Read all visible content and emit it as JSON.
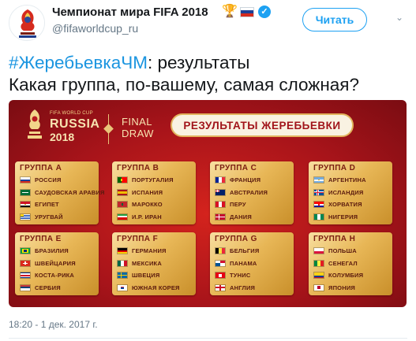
{
  "tweet": {
    "author_name": "Чемпионат мира FIFA 2018",
    "author_handle": "@fifaworldcup_ru",
    "follow_label": "Читать",
    "hashtag": "#ЖеребьевкаЧМ",
    "text_after_hashtag": ": результаты",
    "text_line2": "Какая группа, по-вашему, самая сложная?",
    "timestamp": "18:20 - 1 дек. 2017 г.",
    "icons": [
      "trophy-icon",
      "russia-flag-icon",
      "verified-icon",
      "chevron-down-icon"
    ]
  },
  "media": {
    "logo_small": "FIFA WORLD CUP",
    "logo_country": "RUSSIA",
    "logo_year": "2018",
    "final_draw_line1": "FINAL",
    "final_draw_line2": "DRAW",
    "title": "РЕЗУЛЬТАТЫ ЖЕРЕБЬЕВКИ",
    "groups": [
      {
        "name": "ГРУППА А",
        "teams": [
          {
            "name": "РОССИЯ",
            "flag": "russia-flag"
          },
          {
            "name": "САУДОВСКАЯ АРАВИЯ",
            "flag": "saudi-arabia-flag"
          },
          {
            "name": "ЕГИПЕТ",
            "flag": "egypt-flag"
          },
          {
            "name": "УРУГВАЙ",
            "flag": "uruguay-flag"
          }
        ]
      },
      {
        "name": "ГРУППА B",
        "teams": [
          {
            "name": "ПОРТУГАЛИЯ",
            "flag": "portugal-flag"
          },
          {
            "name": "ИСПАНИЯ",
            "flag": "spain-flag"
          },
          {
            "name": "МАРОККО",
            "flag": "morocco-flag"
          },
          {
            "name": "И.Р. ИРАН",
            "flag": "iran-flag"
          }
        ]
      },
      {
        "name": "ГРУППА C",
        "teams": [
          {
            "name": "ФРАНЦИЯ",
            "flag": "france-flag"
          },
          {
            "name": "АВСТРАЛИЯ",
            "flag": "australia-flag"
          },
          {
            "name": "ПЕРУ",
            "flag": "peru-flag"
          },
          {
            "name": "ДАНИЯ",
            "flag": "denmark-flag"
          }
        ]
      },
      {
        "name": "ГРУППА D",
        "teams": [
          {
            "name": "АРГЕНТИНА",
            "flag": "argentina-flag"
          },
          {
            "name": "ИСЛАНДИЯ",
            "flag": "iceland-flag"
          },
          {
            "name": "ХОРВАТИЯ",
            "flag": "croatia-flag"
          },
          {
            "name": "НИГЕРИЯ",
            "flag": "nigeria-flag"
          }
        ]
      },
      {
        "name": "ГРУППА E",
        "teams": [
          {
            "name": "БРАЗИЛИЯ",
            "flag": "brazil-flag"
          },
          {
            "name": "ШВЕЙЦАРИЯ",
            "flag": "switzerland-flag"
          },
          {
            "name": "КОСТА-РИКА",
            "flag": "costa-rica-flag"
          },
          {
            "name": "СЕРБИЯ",
            "flag": "serbia-flag"
          }
        ]
      },
      {
        "name": "ГРУППА F",
        "teams": [
          {
            "name": "ГЕРМАНИЯ",
            "flag": "germany-flag"
          },
          {
            "name": "МЕКСИКА",
            "flag": "mexico-flag"
          },
          {
            "name": "ШВЕЦИЯ",
            "flag": "sweden-flag"
          },
          {
            "name": "ЮЖНАЯ КОРЕЯ",
            "flag": "south-korea-flag"
          }
        ]
      },
      {
        "name": "ГРУППА G",
        "teams": [
          {
            "name": "БЕЛЬГИЯ",
            "flag": "belgium-flag"
          },
          {
            "name": "ПАНАМА",
            "flag": "panama-flag"
          },
          {
            "name": "ТУНИС",
            "flag": "tunisia-flag"
          },
          {
            "name": "АНГЛИЯ",
            "flag": "england-flag"
          }
        ]
      },
      {
        "name": "ГРУППА H",
        "teams": [
          {
            "name": "ПОЛЬША",
            "flag": "poland-flag"
          },
          {
            "name": "СЕНЕГАЛ",
            "flag": "senegal-flag"
          },
          {
            "name": "КОЛУМБИЯ",
            "flag": "colombia-flag"
          },
          {
            "name": "ЯПОНИЯ",
            "flag": "japan-flag"
          }
        ]
      }
    ]
  },
  "colors": {
    "link_blue": "#1b95e0",
    "follow_blue": "#1da1f2",
    "banner_red": "#c41a1f",
    "card_gold": "#e8b757",
    "muted_gray": "#657786"
  }
}
